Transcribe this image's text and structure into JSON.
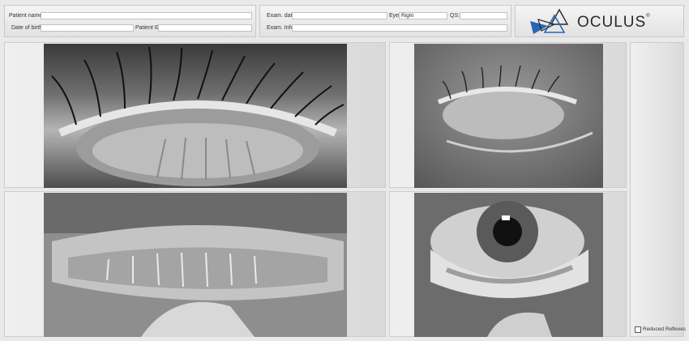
{
  "header": {
    "patient_name_label": "Patient name:",
    "patient_name_value": "",
    "dob_label": "Date of birth:",
    "dob_value": "",
    "patient_id_label": "Patient ID:",
    "patient_id_value": "",
    "exam_date_label": "Exam. date:",
    "exam_date_value": "",
    "eye_label": "Eye:",
    "eye_value": "Right",
    "qs_label": "QS:",
    "qs_value": "",
    "exam_info_label": "Exam. Info:",
    "exam_info_value": ""
  },
  "logo": {
    "text": "OCULUS",
    "mark": "®",
    "icon": "oculus-logo-icon",
    "brand_color": "#2a66b3"
  },
  "options": {
    "reduced_reflexes_label": "Reduced Reflexes",
    "reduced_reflexes_checked": false
  },
  "images": [
    {
      "icon": "upper-eyelid-everted-image"
    },
    {
      "icon": "closed-eyelid-image"
    },
    {
      "icon": "lower-eyelid-everted-image"
    },
    {
      "icon": "lower-eyelid-pulled-image"
    }
  ]
}
